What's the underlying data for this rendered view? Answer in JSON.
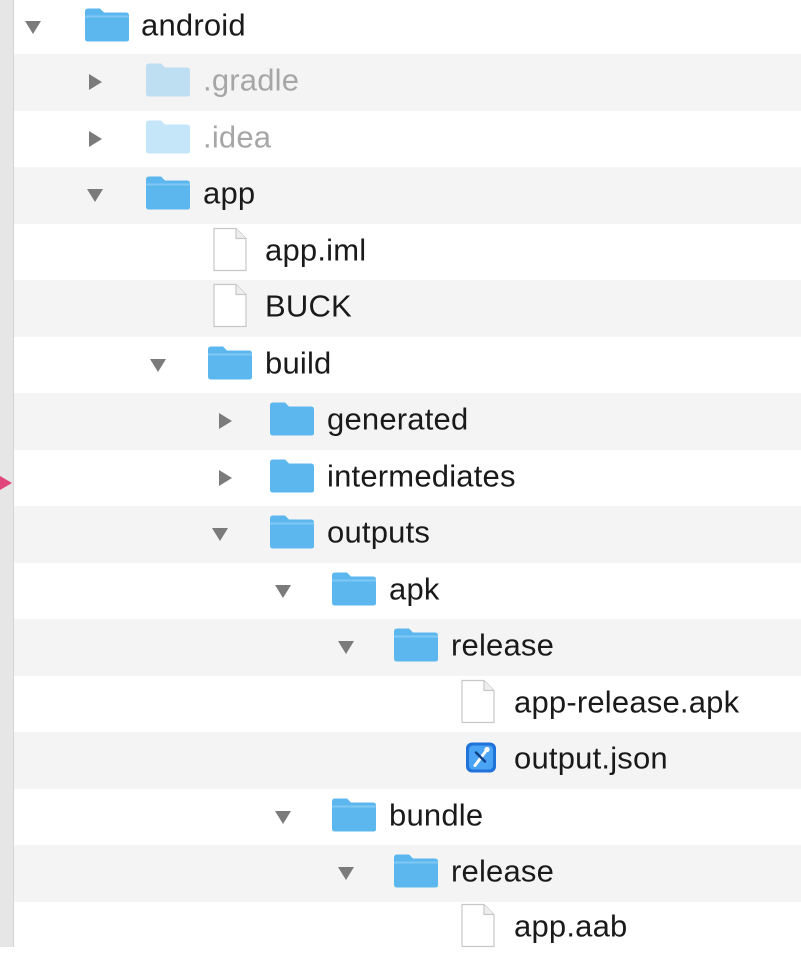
{
  "tree": {
    "rows": [
      {
        "label": "android",
        "type": "folder",
        "expanded": true,
        "dimmed": false
      },
      {
        "label": ".gradle",
        "type": "folder",
        "expanded": false,
        "dimmed": true
      },
      {
        "label": ".idea",
        "type": "folder",
        "expanded": false,
        "dimmed": true
      },
      {
        "label": "app",
        "type": "folder",
        "expanded": true,
        "dimmed": false
      },
      {
        "label": "app.iml",
        "type": "file",
        "dimmed": false
      },
      {
        "label": "BUCK",
        "type": "file",
        "dimmed": false
      },
      {
        "label": "build",
        "type": "folder",
        "expanded": true,
        "dimmed": false
      },
      {
        "label": "generated",
        "type": "folder",
        "expanded": false,
        "dimmed": false
      },
      {
        "label": "intermediates",
        "type": "folder",
        "expanded": false,
        "dimmed": false
      },
      {
        "label": "outputs",
        "type": "folder",
        "expanded": true,
        "dimmed": false
      },
      {
        "label": "apk",
        "type": "folder",
        "expanded": true,
        "dimmed": false
      },
      {
        "label": "release",
        "type": "folder",
        "expanded": true,
        "dimmed": false
      },
      {
        "label": "app-release.apk",
        "type": "file",
        "dimmed": false
      },
      {
        "label": "output.json",
        "type": "json-file",
        "dimmed": false
      },
      {
        "label": "bundle",
        "type": "folder",
        "expanded": true,
        "dimmed": false
      },
      {
        "label": "release",
        "type": "folder",
        "expanded": true,
        "dimmed": false
      },
      {
        "label": "app.aab",
        "type": "file",
        "dimmed": false
      }
    ]
  },
  "colors": {
    "folder_blue": "#5cb7ef",
    "alt_row": "#f4f4f4",
    "marker": "#e0457b"
  },
  "icons": {
    "expanded": "triangle-down-icon",
    "collapsed": "triangle-right-icon",
    "folder": "folder-icon",
    "file": "document-icon",
    "json": "xcode-json-icon"
  }
}
